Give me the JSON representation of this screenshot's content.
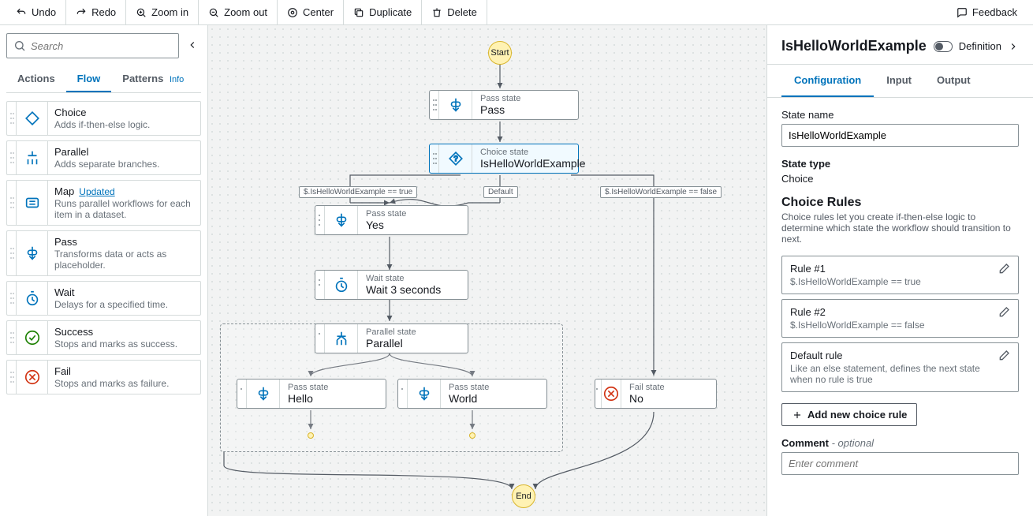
{
  "toolbar": {
    "undo": "Undo",
    "redo": "Redo",
    "zoom_in": "Zoom in",
    "zoom_out": "Zoom out",
    "center": "Center",
    "duplicate": "Duplicate",
    "delete": "Delete",
    "feedback": "Feedback"
  },
  "sidebar": {
    "search_placeholder": "Search",
    "tabs": {
      "actions": "Actions",
      "flow": "Flow",
      "patterns": "Patterns",
      "info": "Info"
    },
    "items": [
      {
        "title": "Choice",
        "desc": "Adds if-then-else logic."
      },
      {
        "title": "Parallel",
        "desc": "Adds separate branches."
      },
      {
        "title": "Map",
        "badge": "Updated",
        "desc": "Runs parallel workflows for each item in a dataset."
      },
      {
        "title": "Pass",
        "desc": "Transforms data or acts as placeholder."
      },
      {
        "title": "Wait",
        "desc": "Delays for a specified time."
      },
      {
        "title": "Success",
        "desc": "Stops and marks as success."
      },
      {
        "title": "Fail",
        "desc": "Stops and marks as failure."
      }
    ]
  },
  "canvas": {
    "start": "Start",
    "end": "End",
    "labels": {
      "true": "$.IsHelloWorldExample == true",
      "default": "Default",
      "false": "$.IsHelloWorldExample == false"
    },
    "nodes": {
      "pass": {
        "type": "Pass state",
        "name": "Pass"
      },
      "choice": {
        "type": "Choice state",
        "name": "IsHelloWorldExample"
      },
      "yes": {
        "type": "Pass state",
        "name": "Yes"
      },
      "wait": {
        "type": "Wait state",
        "name": "Wait 3 seconds"
      },
      "parallel": {
        "type": "Parallel state",
        "name": "Parallel"
      },
      "hello": {
        "type": "Pass state",
        "name": "Hello"
      },
      "world": {
        "type": "Pass state",
        "name": "World"
      },
      "no": {
        "type": "Fail state",
        "name": "No"
      }
    }
  },
  "panel": {
    "title": "IsHelloWorldExample",
    "definition": "Definition",
    "tabs": {
      "configuration": "Configuration",
      "input": "Input",
      "output": "Output"
    },
    "state_name_label": "State name",
    "state_name_value": "IsHelloWorldExample",
    "state_type_label": "State type",
    "state_type_value": "Choice",
    "rules_title": "Choice Rules",
    "rules_desc": "Choice rules let you create if-then-else logic to determine which state the workflow should transition to next.",
    "rules": [
      {
        "title": "Rule #1",
        "cond": "$.IsHelloWorldExample == true"
      },
      {
        "title": "Rule #2",
        "cond": "$.IsHelloWorldExample == false"
      },
      {
        "title": "Default rule",
        "cond": "Like an else statement, defines the next state when no rule is true"
      }
    ],
    "add_rule": "Add new choice rule",
    "comment_label": "Comment",
    "comment_optional": "- optional",
    "comment_placeholder": "Enter comment"
  }
}
